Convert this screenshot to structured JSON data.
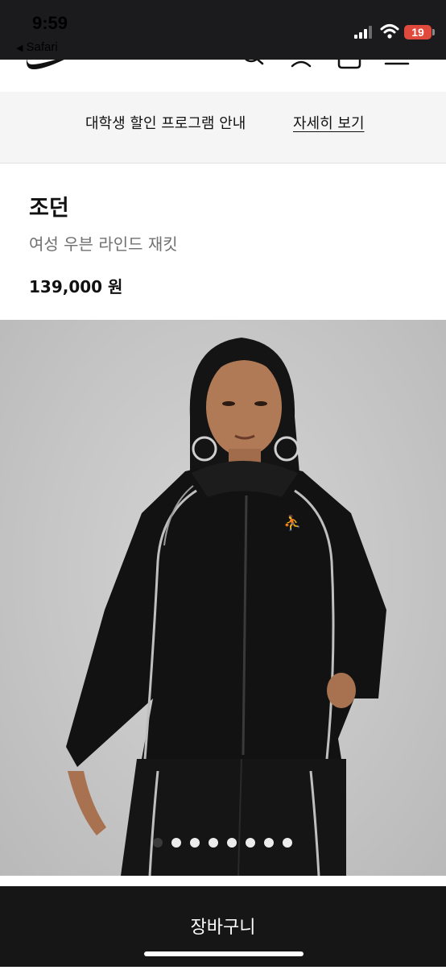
{
  "status_bar": {
    "time": "9:59",
    "back_app": "Safari",
    "battery_level": "19",
    "signal_icon": "cellular-signal-icon",
    "wifi_icon": "wifi-icon",
    "battery_color": "#e04a3d"
  },
  "header": {
    "icons": [
      "nike-logo",
      "search-icon",
      "profile-icon",
      "bag-icon",
      "menu-icon"
    ]
  },
  "promo": {
    "text": "대학생 할인 프로그램 안내",
    "link": "자세히 보기"
  },
  "product": {
    "brand": "조던",
    "name": "여성 우븐 라인드 재킷",
    "price": "139,000 원"
  },
  "gallery": {
    "image_description_icon": "product-photo",
    "total_images": 8,
    "active_index": 0
  },
  "cart": {
    "label": "장바구니",
    "background": "#161616"
  }
}
